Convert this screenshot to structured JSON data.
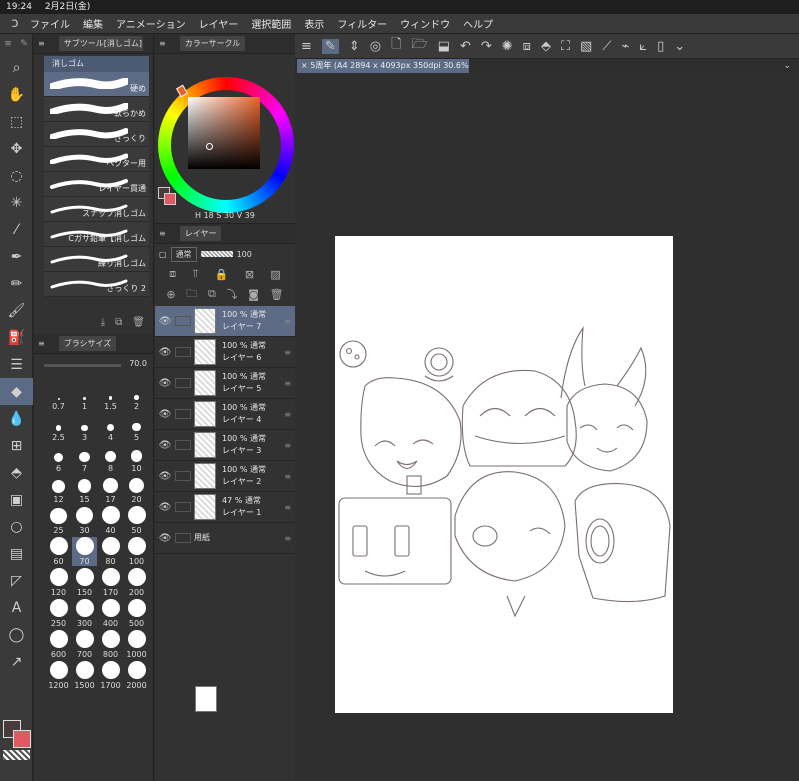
{
  "status": {
    "time": "19:24",
    "date": "2月2日(金)"
  },
  "menu": [
    "ファイル",
    "編集",
    "アニメーション",
    "レイヤー",
    "選択範囲",
    "表示",
    "フィルター",
    "ウィンドウ",
    "ヘルプ"
  ],
  "subtool": {
    "tab_label": "サブツール[消しゴム]",
    "group": "消しゴム",
    "brushes": [
      {
        "name": "硬め",
        "selected": true
      },
      {
        "name": "軟らかめ",
        "selected": false
      },
      {
        "name": "ざっくり",
        "selected": false
      },
      {
        "name": "ベクター用",
        "selected": false
      },
      {
        "name": "レイヤー貫通",
        "selected": false
      },
      {
        "name": "スナップ消しゴム",
        "selected": false
      },
      {
        "name": "Cガサ鉛筆【消しゴム",
        "selected": false
      },
      {
        "name": "練り消しゴム",
        "selected": false
      },
      {
        "name": "ざっくり 2",
        "selected": false
      }
    ]
  },
  "brushsize": {
    "tab_label": "ブラシサイズ",
    "value": "70.0",
    "sizes": [
      "0.7",
      "1",
      "1.5",
      "2",
      "2.5",
      "3",
      "4",
      "5",
      "6",
      "7",
      "8",
      "10",
      "12",
      "15",
      "17",
      "20",
      "25",
      "30",
      "40",
      "50",
      "60",
      "70",
      "80",
      "100",
      "120",
      "150",
      "170",
      "200",
      "250",
      "300",
      "400",
      "500",
      "600",
      "700",
      "800",
      "1000",
      "1200",
      "1500",
      "1700",
      "2000"
    ],
    "selected": "70"
  },
  "colorcircle": {
    "tab_label": "カラーサークル",
    "h": "18",
    "s": "30",
    "v": "39",
    "main_color": "#4a3b3a",
    "sub_color": "#e05a63",
    "hue_color": "#e8622c"
  },
  "layers": {
    "tab_label": "レイヤー",
    "blend_mode": "通常",
    "opacity": "100",
    "items": [
      {
        "opacity": "100 %",
        "mode": "通常",
        "name": "レイヤー 7",
        "selected": true
      },
      {
        "opacity": "100 %",
        "mode": "通常",
        "name": "レイヤー 6",
        "selected": false
      },
      {
        "opacity": "100 %",
        "mode": "通常",
        "name": "レイヤー 5",
        "selected": false
      },
      {
        "opacity": "100 %",
        "mode": "通常",
        "name": "レイヤー 4",
        "selected": false
      },
      {
        "opacity": "100 %",
        "mode": "通常",
        "name": "レイヤー 3",
        "selected": false
      },
      {
        "opacity": "100 %",
        "mode": "通常",
        "name": "レイヤー 2",
        "selected": false
      },
      {
        "opacity": "47 %",
        "mode": "通常",
        "name": "レイヤー 1",
        "selected": false
      },
      {
        "opacity": "",
        "mode": "",
        "name": "用紙",
        "selected": false
      }
    ]
  },
  "document": {
    "tab": "5周年 (A4 2894 x 4093px 350dpi 30.6%)"
  }
}
